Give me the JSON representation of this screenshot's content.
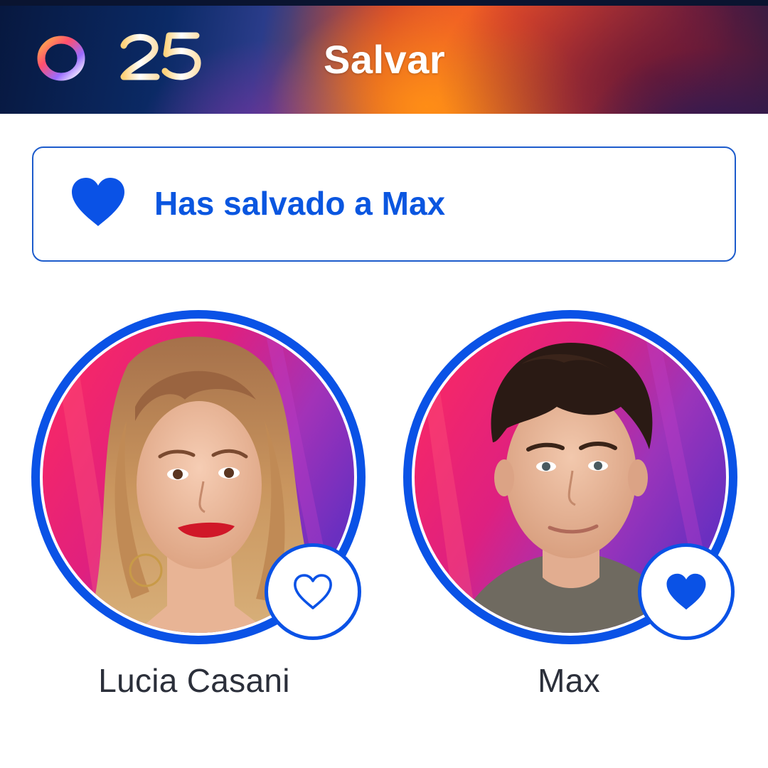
{
  "header": {
    "logo_text": "OT25",
    "title": "Salvar"
  },
  "banner": {
    "icon": "heart-filled-icon",
    "text": "Has salvado a Max"
  },
  "contestants": [
    {
      "name": "Lucia Casani",
      "saved": false,
      "favorite_icon": "heart-outline-icon"
    },
    {
      "name": "Max",
      "saved": true,
      "favorite_icon": "heart-filled-icon"
    }
  ],
  "colors": {
    "accent_blue": "#0a52e6",
    "banner_text": "#0a56e0",
    "name_text": "#2b2f3a"
  }
}
